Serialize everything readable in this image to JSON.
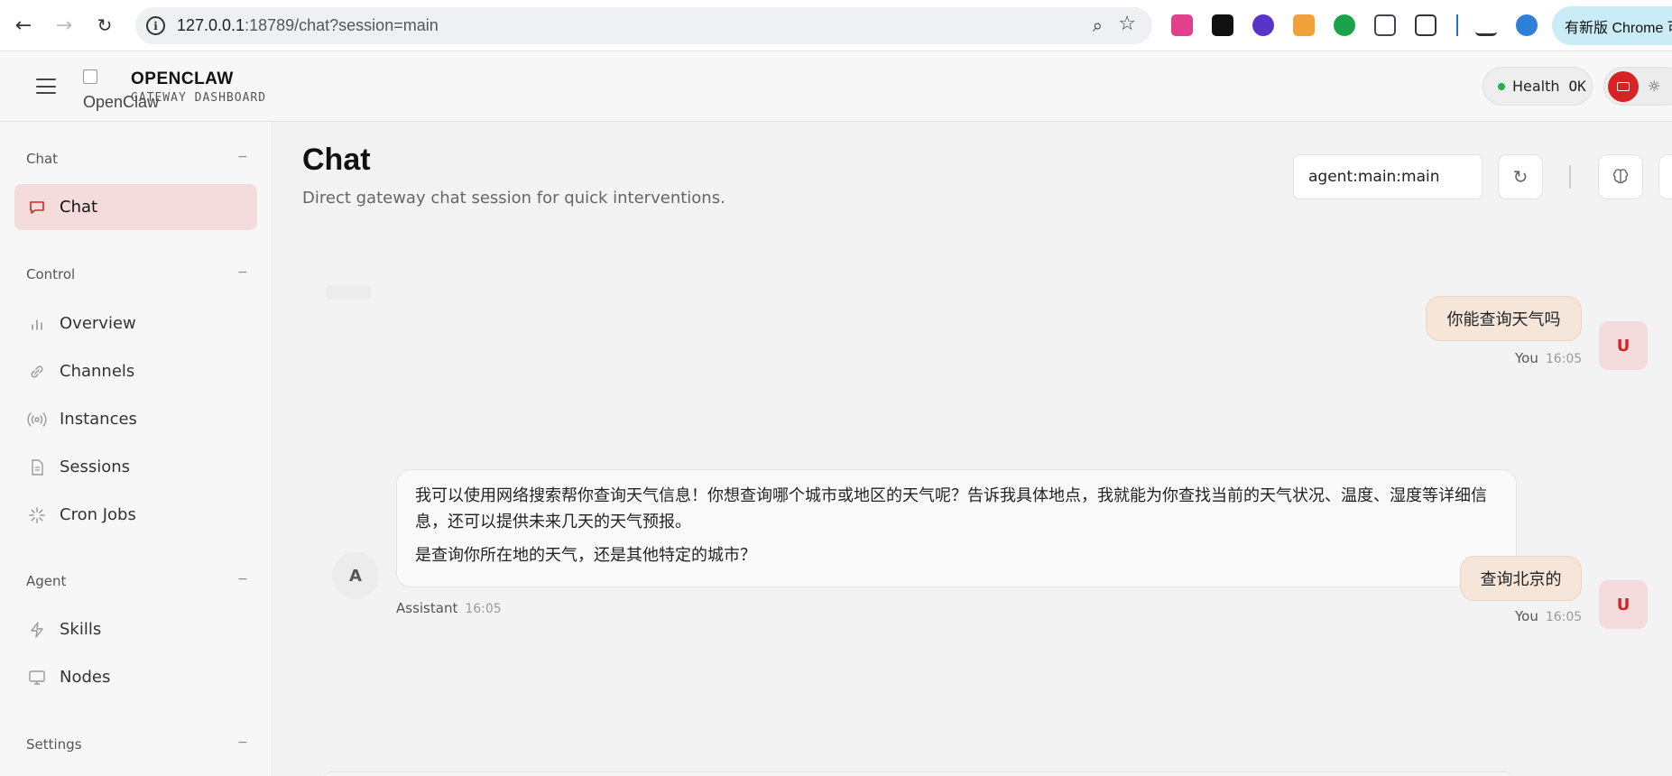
{
  "browser": {
    "url_host": "127.0.0.1",
    "url_rest": ":18789/chat?session=main",
    "update_label": "有新版 Chrome 可用"
  },
  "header": {
    "logo_alt": "OpenClaw",
    "brand_title": "OPENCLAW",
    "brand_subtitle": "GATEWAY DASHBOARD",
    "health_label": "Health",
    "health_status": "OK"
  },
  "sidebar": {
    "sections": [
      {
        "title": "Chat",
        "toggle": "−",
        "items": [
          {
            "label": "Chat",
            "icon": "message-square-icon",
            "active": true
          }
        ]
      },
      {
        "title": "Control",
        "toggle": "−",
        "items": [
          {
            "label": "Overview",
            "icon": "bar-chart-icon"
          },
          {
            "label": "Channels",
            "icon": "link-icon"
          },
          {
            "label": "Instances",
            "icon": "radio-icon"
          },
          {
            "label": "Sessions",
            "icon": "file-text-icon"
          },
          {
            "label": "Cron Jobs",
            "icon": "loader-icon"
          }
        ]
      },
      {
        "title": "Agent",
        "toggle": "−",
        "items": [
          {
            "label": "Skills",
            "icon": "zap-icon"
          },
          {
            "label": "Nodes",
            "icon": "monitor-icon"
          }
        ]
      },
      {
        "title": "Settings",
        "toggle": "−",
        "items": []
      }
    ]
  },
  "main": {
    "title": "Chat",
    "subtitle": "Direct gateway chat session for quick interventions.",
    "session_value": "agent:main:main"
  },
  "messages": [
    {
      "role": "user",
      "avatar": "U",
      "text": "你能查询天气吗",
      "sender": "You",
      "time": "16:05"
    },
    {
      "role": "assistant",
      "avatar": "A",
      "paragraphs": [
        "我可以使用网络搜索帮你查询天气信息！你想查询哪个城市或地区的天气呢？告诉我具体地点，我就能为你查找当前的天气状况、温度、湿度等详细信息，还可以提供未来几天的天气预报。",
        "是查询你所在地的天气，还是其他特定的城市？"
      ],
      "sender": "Assistant",
      "time": "16:05"
    },
    {
      "role": "user",
      "avatar": "U",
      "text": "查询北京的",
      "sender": "You",
      "time": "16:05"
    }
  ],
  "colors": {
    "accent": "#d62424",
    "active_nav_bg": "#f5dcdc",
    "user_bubble": "#f6e6da",
    "health_dot": "#1fb34c"
  }
}
